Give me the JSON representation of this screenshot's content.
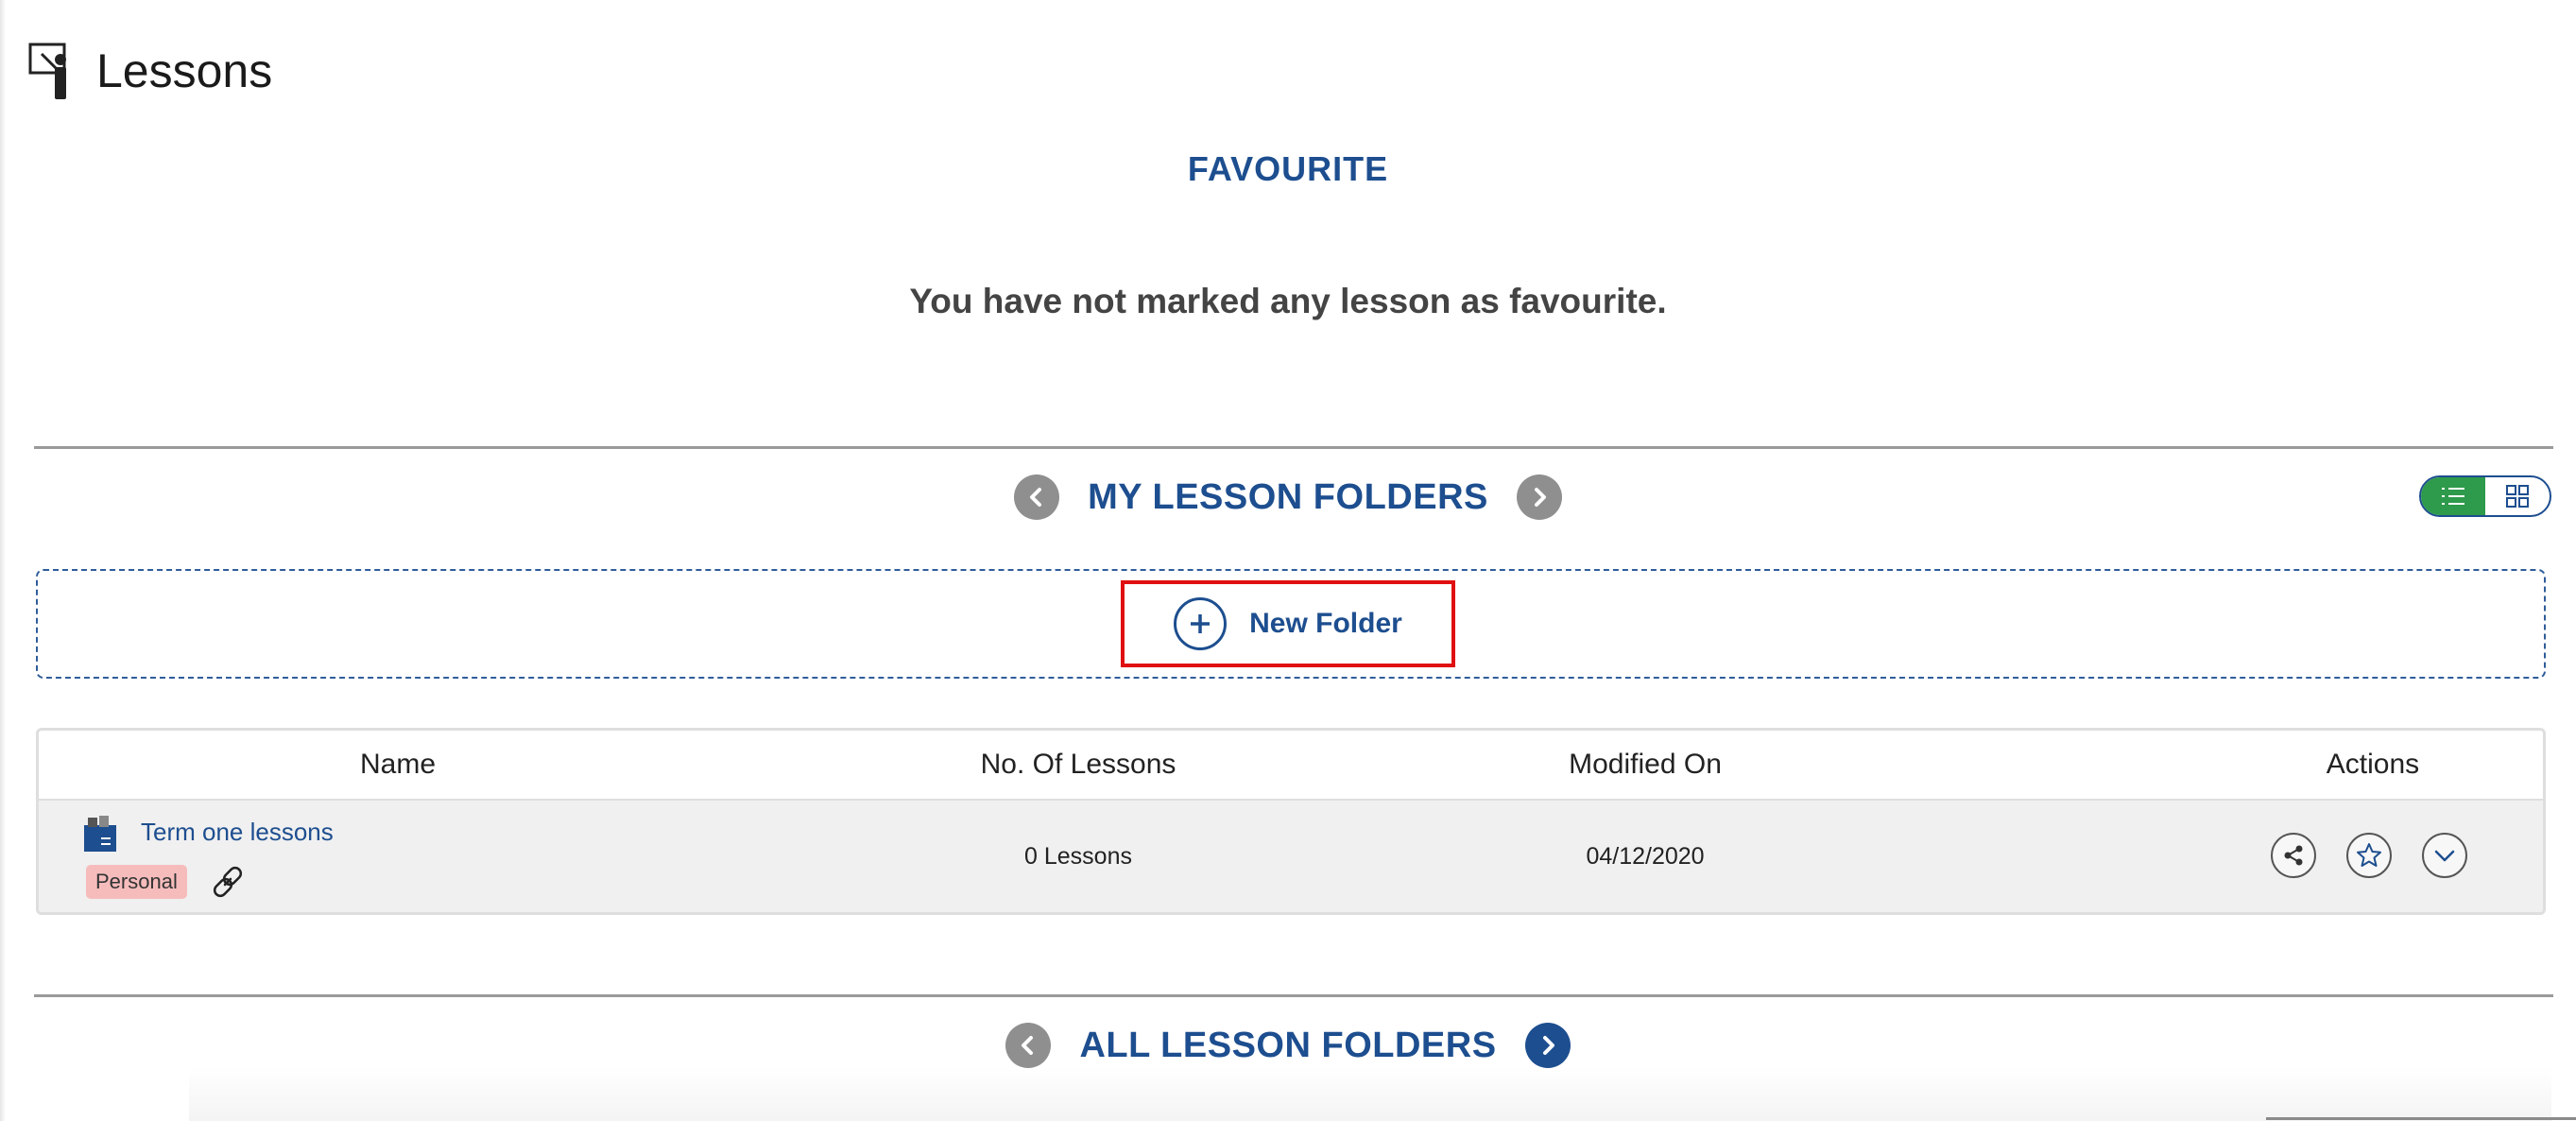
{
  "header": {
    "title": "Lessons",
    "icon": "presenter-icon"
  },
  "favourite": {
    "heading": "FAVOURITE",
    "empty_message": "You have not marked any lesson as favourite."
  },
  "my_folders": {
    "title": "MY LESSON FOLDERS",
    "prev_icon": "chevron-left-icon",
    "next_icon": "chevron-right-icon",
    "view_toggle": {
      "options": [
        "list-view-icon",
        "grid-view-icon"
      ],
      "active": "list"
    },
    "new_folder_label": "New Folder",
    "table": {
      "columns": [
        "Name",
        "No. Of Lessons",
        "Modified On",
        "Actions"
      ],
      "rows": [
        {
          "name": "Term one lessons",
          "badge": "Personal",
          "lessons": "0 Lessons",
          "modified": "04/12/2020",
          "actions": [
            "share-icon",
            "star-icon",
            "chevron-down-icon"
          ]
        }
      ]
    }
  },
  "all_folders": {
    "title": "ALL LESSON FOLDERS",
    "prev_icon": "chevron-left-icon",
    "next_icon": "chevron-right-icon"
  },
  "colors": {
    "accent": "#1d4e8f",
    "active_toggle": "#2e9a4b",
    "highlight_border": "#e01010",
    "badge_bg": "#f6bcbc",
    "nav_gray": "#8f8f8f"
  }
}
